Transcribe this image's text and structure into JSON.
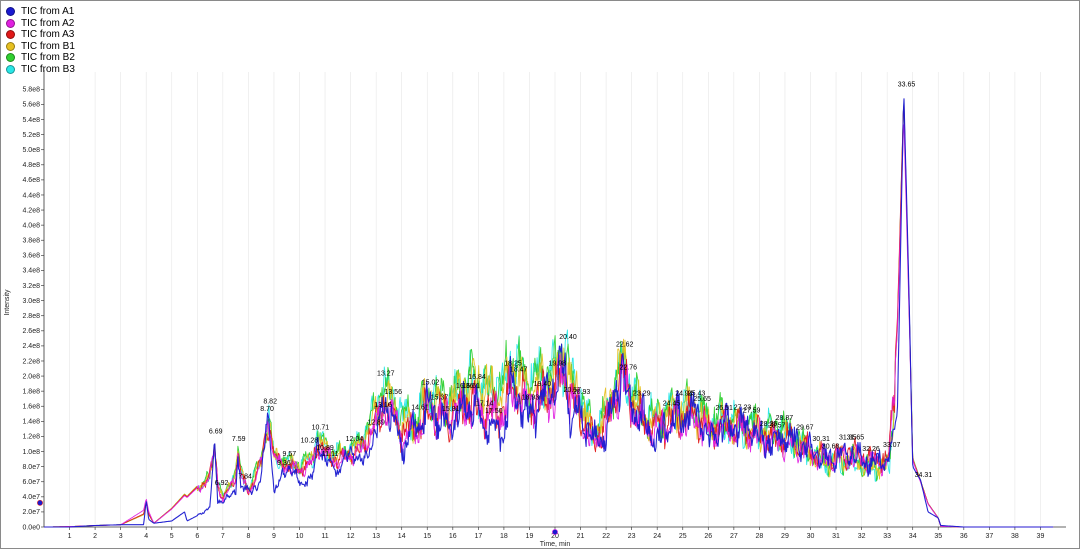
{
  "legend": {
    "items": [
      {
        "label": "TIC from A1",
        "color": "#1a1ad0"
      },
      {
        "label": "TIC from A2",
        "color": "#e020e0"
      },
      {
        "label": "TIC from A3",
        "color": "#e01818"
      },
      {
        "label": "TIC from B1",
        "color": "#e6c020"
      },
      {
        "label": "TIC from B2",
        "color": "#30d030"
      },
      {
        "label": "TIC from B3",
        "color": "#28e6e6"
      }
    ]
  },
  "chart_data": {
    "type": "line",
    "xlabel": "Time, min",
    "ylabel": "Intensity",
    "xlim": [
      0,
      40
    ],
    "ylim": [
      0,
      595000000.0
    ],
    "x_ticks": [
      1,
      2,
      3,
      4,
      5,
      6,
      7,
      8,
      9,
      10,
      11,
      12,
      13,
      14,
      15,
      16,
      17,
      18,
      19,
      20,
      21,
      22,
      23,
      24,
      25,
      26,
      27,
      28,
      29,
      30,
      31,
      32,
      33,
      34,
      35,
      36,
      37,
      38,
      39
    ],
    "y_ticks": [
      {
        "value": 0.0,
        "label": "0.0e0"
      },
      {
        "value": 20000000.0,
        "label": "2.0e7"
      },
      {
        "value": 40000000.0,
        "label": "4.0e7"
      },
      {
        "value": 60000000.0,
        "label": "6.0e7"
      },
      {
        "value": 80000000.0,
        "label": "8.0e7"
      },
      {
        "value": 100000000.0,
        "label": "1.0e8"
      },
      {
        "value": 120000000.0,
        "label": "1.2e8"
      },
      {
        "value": 140000000.0,
        "label": "1.4e8"
      },
      {
        "value": 160000000.0,
        "label": "1.6e8"
      },
      {
        "value": 180000000.0,
        "label": "1.8e8"
      },
      {
        "value": 200000000.0,
        "label": "2.0e8"
      },
      {
        "value": 220000000.0,
        "label": "2.2e8"
      },
      {
        "value": 240000000.0,
        "label": "2.4e8"
      },
      {
        "value": 260000000.0,
        "label": "2.6e8"
      },
      {
        "value": 280000000.0,
        "label": "2.8e8"
      },
      {
        "value": 300000000.0,
        "label": "3.0e8"
      },
      {
        "value": 320000000.0,
        "label": "3.2e8"
      },
      {
        "value": 340000000.0,
        "label": "3.4e8"
      },
      {
        "value": 360000000.0,
        "label": "3.6e8"
      },
      {
        "value": 380000000.0,
        "label": "3.8e8"
      },
      {
        "value": 400000000.0,
        "label": "4.0e8"
      },
      {
        "value": 420000000.0,
        "label": "4.2e8"
      },
      {
        "value": 440000000.0,
        "label": "4.4e8"
      },
      {
        "value": 460000000.0,
        "label": "4.6e8"
      },
      {
        "value": 480000000.0,
        "label": "4.8e8"
      },
      {
        "value": 500000000.0,
        "label": "5.0e8"
      },
      {
        "value": 520000000.0,
        "label": "5.2e8"
      },
      {
        "value": 540000000.0,
        "label": "5.4e8"
      },
      {
        "value": 560000000.0,
        "label": "5.6e8"
      },
      {
        "value": 580000000.0,
        "label": "5.8e8"
      }
    ],
    "grid": true,
    "legend_position": "top-left",
    "peak_labels": [
      {
        "label": "6.69",
        "x": 6.69,
        "y": 120000000.0
      },
      {
        "label": "6.92",
        "x": 6.92,
        "y": 52000000.0
      },
      {
        "label": "7.59",
        "x": 7.59,
        "y": 110000000.0
      },
      {
        "label": "7.84",
        "x": 7.84,
        "y": 60000000.0
      },
      {
        "label": "8.70",
        "x": 8.7,
        "y": 150000000.0
      },
      {
        "label": "8.82",
        "x": 8.82,
        "y": 160000000.0
      },
      {
        "label": "9.57",
        "x": 9.57,
        "y": 90000000.0
      },
      {
        "label": "9.36",
        "x": 9.36,
        "y": 78000000.0
      },
      {
        "label": "10.71",
        "x": 10.71,
        "y": 125000000.0
      },
      {
        "label": "10.28",
        "x": 10.28,
        "y": 108000000.0
      },
      {
        "label": "11.11",
        "x": 11.11,
        "y": 90000000.0
      },
      {
        "label": "10.89",
        "x": 10.89,
        "y": 98000000.0
      },
      {
        "label": "12.04",
        "x": 12.04,
        "y": 110000000.0
      },
      {
        "label": "12.89",
        "x": 12.89,
        "y": 132000000.0
      },
      {
        "label": "13.16",
        "x": 13.16,
        "y": 155000000.0
      },
      {
        "label": "13.27",
        "x": 13.27,
        "y": 197000000.0
      },
      {
        "label": "13.56",
        "x": 13.56,
        "y": 172000000.0
      },
      {
        "label": "14.61",
        "x": 14.61,
        "y": 152000000.0
      },
      {
        "label": "15.02",
        "x": 15.02,
        "y": 185000000.0
      },
      {
        "label": "15.37",
        "x": 15.37,
        "y": 165000000.0
      },
      {
        "label": "15.81",
        "x": 15.81,
        "y": 150000000.0
      },
      {
        "label": "16.36",
        "x": 16.36,
        "y": 180000000.0
      },
      {
        "label": "16.84",
        "x": 16.84,
        "y": 192000000.0
      },
      {
        "label": "16.61",
        "x": 16.61,
        "y": 180000000.0
      },
      {
        "label": "17.14",
        "x": 17.14,
        "y": 157000000.0
      },
      {
        "label": "17.50",
        "x": 17.5,
        "y": 147000000.0
      },
      {
        "label": "18.25",
        "x": 18.25,
        "y": 210000000.0
      },
      {
        "label": "18.47",
        "x": 18.47,
        "y": 202000000.0
      },
      {
        "label": "18.93",
        "x": 18.93,
        "y": 165000000.0
      },
      {
        "label": "19.40",
        "x": 19.4,
        "y": 183000000.0
      },
      {
        "label": "19.98",
        "x": 19.98,
        "y": 210000000.0
      },
      {
        "label": "20.40",
        "x": 20.4,
        "y": 245000000.0
      },
      {
        "label": "20.57",
        "x": 20.57,
        "y": 175000000.0
      },
      {
        "label": "20.93",
        "x": 20.93,
        "y": 172000000.0
      },
      {
        "label": "22.62",
        "x": 22.62,
        "y": 235000000.0
      },
      {
        "label": "22.76",
        "x": 22.76,
        "y": 205000000.0
      },
      {
        "label": "23.29",
        "x": 23.29,
        "y": 170000000.0
      },
      {
        "label": "24.45",
        "x": 24.45,
        "y": 157000000.0
      },
      {
        "label": "24.94",
        "x": 24.94,
        "y": 170000000.0
      },
      {
        "label": "25.43",
        "x": 25.43,
        "y": 170000000.0
      },
      {
        "label": "25.65",
        "x": 25.65,
        "y": 163000000.0
      },
      {
        "label": "26.51",
        "x": 26.51,
        "y": 151000000.0
      },
      {
        "label": "27.23",
        "x": 27.23,
        "y": 152000000.0
      },
      {
        "label": "27.59",
        "x": 27.59,
        "y": 148000000.0
      },
      {
        "label": "28.25",
        "x": 28.25,
        "y": 130000000.0
      },
      {
        "label": "28.87",
        "x": 28.87,
        "y": 138000000.0
      },
      {
        "label": "28.57",
        "x": 28.57,
        "y": 128000000.0
      },
      {
        "label": "29.67",
        "x": 29.67,
        "y": 125000000.0
      },
      {
        "label": "30.31",
        "x": 30.31,
        "y": 110000000.0
      },
      {
        "label": "30.68",
        "x": 30.68,
        "y": 100000000.0
      },
      {
        "label": "31.35",
        "x": 31.35,
        "y": 112000000.0
      },
      {
        "label": "31.65",
        "x": 31.65,
        "y": 112000000.0
      },
      {
        "label": "32.26",
        "x": 32.26,
        "y": 97000000.0
      },
      {
        "label": "33.07",
        "x": 33.07,
        "y": 102000000.0
      },
      {
        "label": "33.65",
        "x": 33.65,
        "y": 580000000.0
      },
      {
        "label": "34.31",
        "x": 34.31,
        "y": 62000000.0
      }
    ],
    "series": [
      {
        "name": "TIC from A1",
        "color": "#1a1ad0",
        "scale": 0.9,
        "x": [
          0,
          1,
          2,
          3,
          3.9,
          4.0,
          4.1,
          4.3,
          5.0,
          5.5,
          5.6,
          6.0,
          6.5,
          6.69,
          6.8,
          7.0,
          7.5,
          7.59,
          7.7,
          8.0,
          8.5,
          8.7,
          8.82,
          9.0,
          9.36,
          9.57,
          10.0,
          10.5,
          10.71,
          11.11,
          11.5,
          12.04,
          12.5,
          12.89,
          13.16,
          13.27,
          13.56,
          14.0,
          14.61,
          15.02,
          15.37,
          15.81,
          16.36,
          16.61,
          16.84,
          17.14,
          17.5,
          18.0,
          18.25,
          18.47,
          18.93,
          19.4,
          19.98,
          20.4,
          20.57,
          20.93,
          21.5,
          22.0,
          22.62,
          22.76,
          23.29,
          24.0,
          24.45,
          24.94,
          25.43,
          25.65,
          26.0,
          26.51,
          27.23,
          27.59,
          28.25,
          28.57,
          28.87,
          29.67,
          30.31,
          30.68,
          31.35,
          31.65,
          32.26,
          33.07,
          33.4,
          33.65,
          33.85,
          34.0,
          34.31,
          34.6,
          35.0,
          35.1,
          36,
          37,
          38,
          39,
          39.5
        ],
        "y": [
          0,
          0,
          2000000.0,
          3000000.0,
          3000000.0,
          35000000.0,
          10000000.0,
          5000000.0,
          8000000.0,
          20000000.0,
          8000000.0,
          15000000.0,
          30000000.0,
          120000000.0,
          35000000.0,
          40000000.0,
          50000000.0,
          110000000.0,
          60000000.0,
          50000000.0,
          65000000.0,
          150000000.0,
          160000000.0,
          50000000.0,
          78000000.0,
          90000000.0,
          65000000.0,
          70000000.0,
          125000000.0,
          90000000.0,
          80000000.0,
          110000000.0,
          90000000.0,
          132000000.0,
          155000000.0,
          197000000.0,
          172000000.0,
          120000000.0,
          152000000.0,
          185000000.0,
          165000000.0,
          150000000.0,
          180000000.0,
          180000000.0,
          192000000.0,
          157000000.0,
          147000000.0,
          140000000.0,
          210000000.0,
          202000000.0,
          165000000.0,
          183000000.0,
          210000000.0,
          245000000.0,
          175000000.0,
          172000000.0,
          130000000.0,
          140000000.0,
          235000000.0,
          205000000.0,
          170000000.0,
          130000000.0,
          157000000.0,
          170000000.0,
          170000000.0,
          163000000.0,
          130000000.0,
          151000000.0,
          152000000.0,
          148000000.0,
          130000000.0,
          128000000.0,
          138000000.0,
          125000000.0,
          110000000.0,
          100000000.0,
          112000000.0,
          112000000.0,
          97000000.0,
          102000000.0,
          150000000.0,
          580000000.0,
          320000000.0,
          80000000.0,
          62000000.0,
          20000000.0,
          12000000.0,
          2000000.0,
          0,
          0,
          0,
          0,
          0
        ]
      },
      {
        "name": "TIC from A2",
        "color": "#e020e0",
        "scale": 0.93,
        "x": [
          0,
          3,
          4.0,
          4.3,
          6.69,
          7.0,
          7.59,
          8.0,
          8.82,
          9.57,
          10.71,
          12.04,
          13.27,
          14.61,
          15.02,
          16.84,
          18.25,
          19.98,
          20.4,
          21.5,
          22.62,
          23.29,
          25.43,
          27.23,
          28.87,
          30.31,
          31.65,
          33.07,
          33.65,
          34.0,
          34.31,
          35.0,
          35.1,
          39.5
        ],
        "y": [
          0,
          3000000.0,
          42000000.0,
          5000000.0,
          115000000.0,
          40000000.0,
          105000000.0,
          50000000.0,
          155000000.0,
          88000000.0,
          120000000.0,
          105000000.0,
          190000000.0,
          148000000.0,
          180000000.0,
          188000000.0,
          205000000.0,
          205000000.0,
          240000000.0,
          125000000.0,
          230000000.0,
          165000000.0,
          168000000.0,
          150000000.0,
          135000000.0,
          108000000.0,
          110000000.0,
          100000000.0,
          550000000.0,
          100000000.0,
          60000000.0,
          12000000.0,
          0,
          0
        ]
      },
      {
        "name": "TIC from A3",
        "color": "#e01818",
        "scale": 0.96,
        "x": [
          0,
          3,
          4.0,
          4.3,
          6.69,
          7.0,
          7.59,
          8.0,
          8.82,
          9.57,
          10.71,
          12.04,
          13.27,
          14.61,
          15.02,
          16.84,
          18.25,
          19.98,
          20.4,
          21.5,
          22.62,
          23.29,
          25.43,
          27.23,
          28.87,
          30.31,
          31.65,
          33.07,
          33.65,
          34.0,
          34.31,
          35.0,
          35.1,
          39.5
        ],
        "y": [
          0,
          3000000.0,
          32000000.0,
          5000000.0,
          118000000.0,
          40000000.0,
          108000000.0,
          52000000.0,
          158000000.0,
          90000000.0,
          122000000.0,
          108000000.0,
          195000000.0,
          150000000.0,
          183000000.0,
          190000000.0,
          208000000.0,
          208000000.0,
          242000000.0,
          130000000.0,
          233000000.0,
          168000000.0,
          172000000.0,
          153000000.0,
          140000000.0,
          112000000.0,
          115000000.0,
          105000000.0,
          585000000.0,
          100000000.0,
          62000000.0,
          12000000.0,
          0,
          0
        ]
      },
      {
        "name": "TIC from B1",
        "color": "#e6c020",
        "scale": 1.0,
        "x": [
          0,
          3,
          4.0,
          4.3,
          6.69,
          7.0,
          7.59,
          8.0,
          8.82,
          9.57,
          10.71,
          12.04,
          13.27,
          14.61,
          15.02,
          16.84,
          18.25,
          19.98,
          20.4,
          21.5,
          22.62,
          23.29,
          25.43,
          27.23,
          28.87,
          30.31,
          31.65,
          33.07,
          33.65,
          34.0,
          34.31,
          35.0,
          35.1,
          39.5
        ],
        "y": [
          0,
          3000000.0,
          30000000.0,
          5000000.0,
          120000000.0,
          42000000.0,
          110000000.0,
          55000000.0,
          160000000.0,
          95000000.0,
          130000000.0,
          115000000.0,
          210000000.0,
          160000000.0,
          200000000.0,
          250000000.0,
          260000000.0,
          230000000.0,
          280000000.0,
          140000000.0,
          275000000.0,
          180000000.0,
          180000000.0,
          155000000.0,
          145000000.0,
          100000000.0,
          95000000.0,
          85000000.0,
          560000000.0,
          100000000.0,
          60000000.0,
          12000000.0,
          0,
          0
        ]
      },
      {
        "name": "TIC from B2",
        "color": "#30d030",
        "scale": 1.02,
        "x": [
          0,
          3,
          4.0,
          4.3,
          6.69,
          7.0,
          7.59,
          8.0,
          8.82,
          9.57,
          10.71,
          12.04,
          13.27,
          14.61,
          15.02,
          16.84,
          18.25,
          19.98,
          20.4,
          21.5,
          22.62,
          23.29,
          25.43,
          27.23,
          28.87,
          30.31,
          31.65,
          33.07,
          33.65,
          34.0,
          34.31,
          35.0,
          35.1,
          39.5
        ],
        "y": [
          0,
          3000000.0,
          30000000.0,
          5000000.0,
          120000000.0,
          45000000.0,
          112000000.0,
          60000000.0,
          162000000.0,
          98000000.0,
          135000000.0,
          120000000.0,
          230000000.0,
          170000000.0,
          210000000.0,
          245000000.0,
          280000000.0,
          250000000.0,
          290000000.0,
          150000000.0,
          265000000.0,
          190000000.0,
          195000000.0,
          160000000.0,
          160000000.0,
          100000000.0,
          90000000.0,
          80000000.0,
          550000000.0,
          100000000.0,
          60000000.0,
          12000000.0,
          0,
          0
        ]
      },
      {
        "name": "TIC from B3",
        "color": "#28e6e6",
        "scale": 1.01,
        "x": [
          0,
          3,
          4.0,
          4.3,
          6.69,
          7.0,
          7.59,
          8.0,
          8.82,
          9.57,
          10.71,
          12.04,
          13.27,
          14.61,
          15.02,
          16.84,
          18.25,
          19.98,
          20.4,
          21.5,
          22.62,
          23.29,
          25.43,
          27.23,
          28.87,
          30.31,
          31.65,
          33.07,
          33.65,
          34.0,
          34.31,
          35.0,
          35.1,
          39.5
        ],
        "y": [
          0,
          3000000.0,
          30000000.0,
          5000000.0,
          118000000.0,
          45000000.0,
          110000000.0,
          58000000.0,
          160000000.0,
          96000000.0,
          133000000.0,
          120000000.0,
          235000000.0,
          170000000.0,
          205000000.0,
          240000000.0,
          275000000.0,
          245000000.0,
          285000000.0,
          145000000.0,
          260000000.0,
          185000000.0,
          190000000.0,
          155000000.0,
          155000000.0,
          95000000.0,
          85000000.0,
          75000000.0,
          565000000.0,
          100000000.0,
          60000000.0,
          12000000.0,
          0,
          0
        ]
      }
    ]
  }
}
